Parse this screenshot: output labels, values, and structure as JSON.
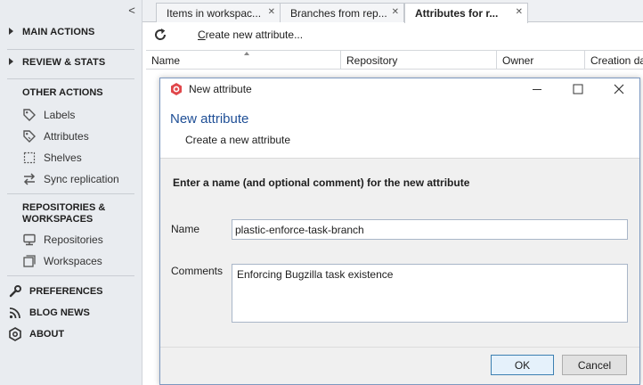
{
  "sidebar": {
    "collapse_glyph": "<",
    "main_actions": "MAIN ACTIONS",
    "review_stats": "REVIEW & STATS",
    "other_actions": "OTHER ACTIONS",
    "other_items": [
      {
        "label": "Labels",
        "icon": "tag-icon"
      },
      {
        "label": "Attributes",
        "icon": "attribute-tag-icon"
      },
      {
        "label": "Shelves",
        "icon": "shelve-icon"
      },
      {
        "label": "Sync replication",
        "icon": "sync-icon"
      }
    ],
    "repos_line1": "REPOSITORIES &",
    "repos_line2": "WORKSPACES",
    "repo_items": [
      {
        "label": "Repositories",
        "icon": "repository-icon"
      },
      {
        "label": "Workspaces",
        "icon": "workspace-icon"
      }
    ],
    "preferences": "PREFERENCES",
    "blog_news": "BLOG NEWS",
    "about": "ABOUT"
  },
  "tabs": [
    {
      "label": "Items in workspac...",
      "active": false
    },
    {
      "label": "Branches from rep...",
      "active": false
    },
    {
      "label": "Attributes for r...",
      "active": true
    }
  ],
  "toolbar": {
    "create_label_u": "C",
    "create_label_rest": "reate new attribute..."
  },
  "grid": {
    "columns": [
      "Name",
      "Repository",
      "Owner",
      "Creation da"
    ]
  },
  "dialog": {
    "title": "New attribute",
    "heading": "New attribute",
    "subheading": "Create a new attribute",
    "instruction": "Enter a name (and optional comment) for the new attribute",
    "name_label": "Name",
    "name_value": "plastic-enforce-task-branch",
    "comments_label": "Comments",
    "comments_value": "Enforcing Bugzilla task existence",
    "ok_label": "OK",
    "cancel_label": "Cancel"
  },
  "colors": {
    "accent": "#1f4f96",
    "sidebar_bg": "#e9ecf0",
    "logo": "#e0464a"
  }
}
